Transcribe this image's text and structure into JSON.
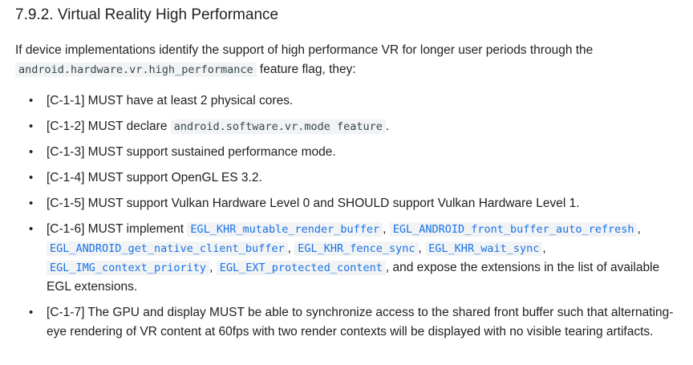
{
  "section": {
    "title": "7.9.2. Virtual Reality High Performance"
  },
  "intro": {
    "text_before": "If device implementations identify the support of high performance VR for longer user periods through the ",
    "code": "android.hardware.vr.high_performance",
    "text_after": " feature flag, they:"
  },
  "requirements": [
    {
      "text": "[C-1-1] MUST have at least 2 physical cores."
    },
    {
      "text": "[C-1-2] MUST declare ",
      "code": "android.software.vr.mode feature",
      "after": "."
    },
    {
      "text": "[C-1-3] MUST support sustained performance mode."
    },
    {
      "text": "[C-1-4] MUST support OpenGL ES 3.2."
    },
    {
      "text": "[C-1-5] MUST support Vulkan Hardware Level 0 and SHOULD support Vulkan Hardware Level 1."
    },
    {
      "text": "[C-1-6] MUST implement ",
      "links": [
        "EGL_KHR_mutable_render_buffer",
        "EGL_ANDROID_front_buffer_auto_refresh",
        "EGL_ANDROID_get_native_client_buffer",
        "EGL_KHR_fence_sync",
        "EGL_KHR_wait_sync",
        "EGL_IMG_context_priority",
        "EGL_EXT_protected_content"
      ],
      "after": ", and expose the extensions in the list of available EGL extensions."
    },
    {
      "text": "[C-1-7] The GPU and display MUST be able to synchronize access to the shared front buffer such that alternating-eye rendering of VR content at 60fps with two render contexts will be displayed with no visible tearing artifacts."
    }
  ],
  "bullet_glyph": "•",
  "separator": ", "
}
